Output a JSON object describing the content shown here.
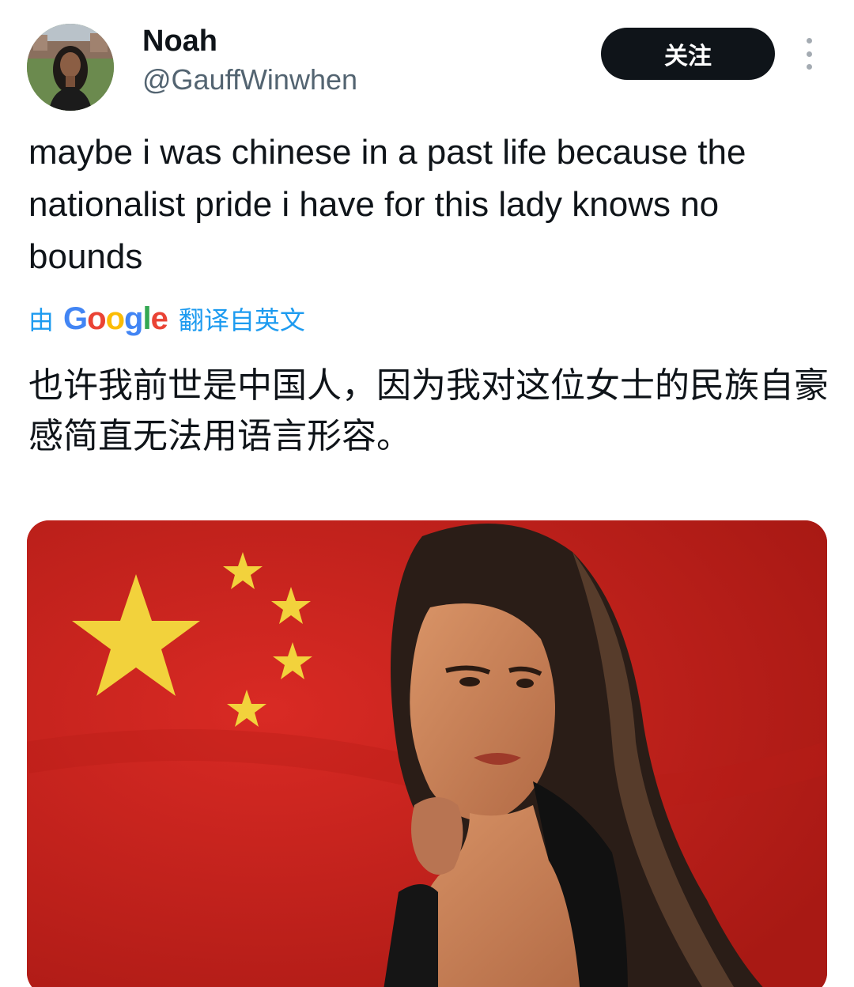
{
  "author": {
    "display_name": "Noah",
    "handle": "@GauffWinwhen"
  },
  "actions": {
    "follow_label": "关注",
    "more_icon": "more-vertical-icon"
  },
  "tweet": {
    "text": "maybe i was chinese in a past life because the nationalist pride i have for this lady knows no bounds",
    "translate_by": "由",
    "translate_service": "Google",
    "translate_label": "翻译自英文",
    "translated_text": "也许我前世是中国人，因为我对这位女士的民族自豪感简直无法用语言形容。"
  },
  "colors": {
    "link": "#1d9bf0",
    "follow_bg": "#0f1419",
    "flag_red": "#c8231f",
    "flag_star": "#f2d23c"
  }
}
